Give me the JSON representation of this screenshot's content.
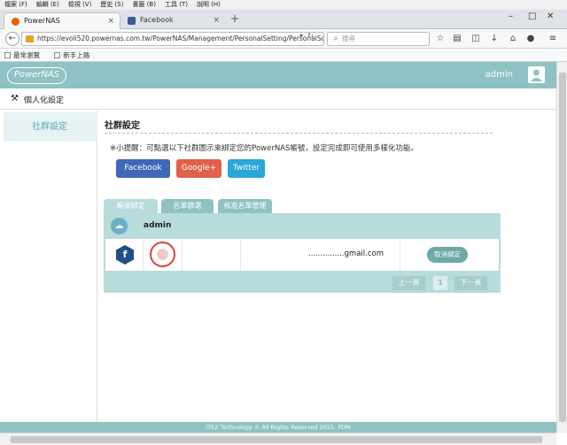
{
  "browser": {
    "menu": [
      "檔案 (F)",
      "編輯 (E)",
      "檢視 (V)",
      "歷史 (S)",
      "書籤 (B)",
      "工具 (T)",
      "說明 (H)"
    ],
    "tabs": [
      {
        "label": "PowerNAS",
        "close": "×"
      },
      {
        "label": "Facebook",
        "close": "×"
      }
    ],
    "new_tab": "+",
    "url": "https://evoli520.powernas.com.tw/PowerNAS/Management/PersonalSetting/PersonalSo",
    "search_placeholder": "搜尋",
    "bookmarks": [
      "最常瀏覽",
      "新手上路"
    ],
    "colors": {
      "firefox_tab_icon": "#e66000",
      "facebook_tab_icon": "#3b5998"
    }
  },
  "app": {
    "logo": "PowerNAS",
    "user": "admin",
    "page_title": "個人化設定",
    "sidebar": {
      "items": [
        {
          "label": "社群設定",
          "active": true
        }
      ]
    },
    "section_title": "社群設定",
    "tip": "※小提醒：可點選以下社群圖示來綁定您的PowerNAS帳號，設定完成即可使用多樣化功能。",
    "social_buttons": [
      {
        "label": "Facebook",
        "color": "#3e68b8"
      },
      {
        "label": "Google+",
        "color": "#e0604a"
      },
      {
        "label": "Twitter",
        "color": "#2aa6d8"
      }
    ],
    "panel_tabs": [
      {
        "label": "帳號綁定",
        "active": true
      },
      {
        "label": "名單篩選",
        "active": false
      },
      {
        "label": "核准名單管理",
        "active": false
      }
    ],
    "panel_user": "admin",
    "accounts": [
      {
        "provider": "facebook",
        "provider_icon": "f",
        "email": "...............gmail.com",
        "action": "取消綁定"
      }
    ],
    "pager": {
      "prev": "上一頁",
      "page": "1",
      "next": "下一頁"
    },
    "footer": "ITE2 Technology © All Rights Reserved 2015. PDM",
    "accent_color": "#8ec2c3"
  }
}
